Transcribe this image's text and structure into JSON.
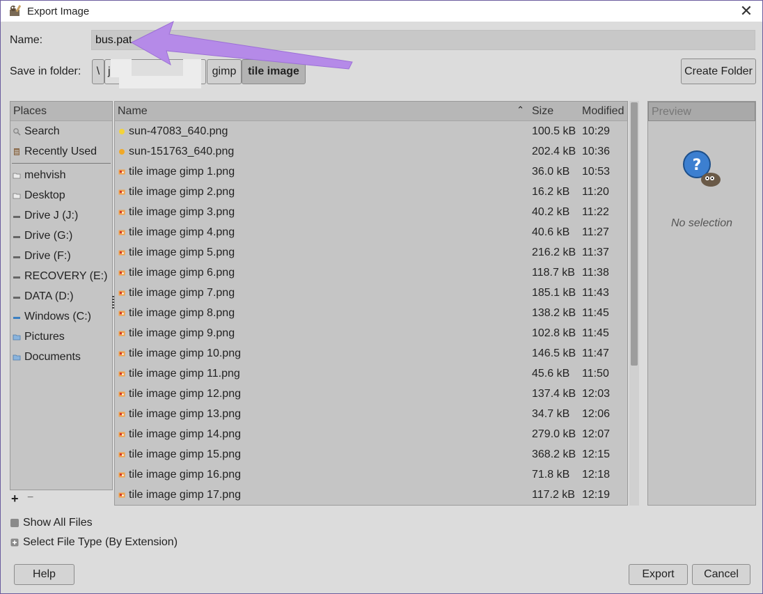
{
  "window": {
    "title": "Export Image",
    "close_icon": "close-icon"
  },
  "name_row": {
    "label": "Name:",
    "value": "bus.pat"
  },
  "folder_row": {
    "label": "Save in folder:",
    "crumbs": [
      "\\",
      "j",
      "gimp",
      "tile image"
    ],
    "create_folder": "Create Folder"
  },
  "places": {
    "header": "Places",
    "items": [
      {
        "label": "Search",
        "icon": "search-icon"
      },
      {
        "label": "Recently Used",
        "icon": "recent-icon"
      },
      {
        "label": "mehvish",
        "icon": "folder-icon"
      },
      {
        "label": "Desktop",
        "icon": "folder-icon"
      },
      {
        "label": "Drive J (J:)",
        "icon": "drive-icon"
      },
      {
        "label": "Drive (G:)",
        "icon": "drive-icon"
      },
      {
        "label": "Drive (F:)",
        "icon": "drive-icon"
      },
      {
        "label": "RECOVERY (E:)",
        "icon": "drive-icon"
      },
      {
        "label": "DATA (D:)",
        "icon": "drive-icon"
      },
      {
        "label": "Windows (C:)",
        "icon": "drive-icon"
      },
      {
        "label": "Pictures",
        "icon": "folder-icon"
      },
      {
        "label": "Documents",
        "icon": "folder-icon"
      }
    ],
    "add": "+",
    "remove": "−"
  },
  "files": {
    "headers": {
      "name": "Name",
      "size": "Size",
      "modified": "Modified"
    },
    "rows": [
      {
        "name": "sun-47083_640.png",
        "size": "100.5 kB",
        "modified": "10:29"
      },
      {
        "name": "sun-151763_640.png",
        "size": "202.4 kB",
        "modified": "10:36"
      },
      {
        "name": "tile image gimp 1.png",
        "size": "36.0 kB",
        "modified": "10:53"
      },
      {
        "name": "tile image gimp 2.png",
        "size": "16.2 kB",
        "modified": "11:20"
      },
      {
        "name": "tile image gimp 3.png",
        "size": "40.2 kB",
        "modified": "11:22"
      },
      {
        "name": "tile image gimp 4.png",
        "size": "40.6 kB",
        "modified": "11:27"
      },
      {
        "name": "tile image gimp 5.png",
        "size": "216.2 kB",
        "modified": "11:37"
      },
      {
        "name": "tile image gimp 6.png",
        "size": "118.7 kB",
        "modified": "11:38"
      },
      {
        "name": "tile image gimp 7.png",
        "size": "185.1 kB",
        "modified": "11:43"
      },
      {
        "name": "tile image gimp 8.png",
        "size": "138.2 kB",
        "modified": "11:45"
      },
      {
        "name": "tile image gimp 9.png",
        "size": "102.8 kB",
        "modified": "11:45"
      },
      {
        "name": "tile image gimp 10.png",
        "size": "146.5 kB",
        "modified": "11:47"
      },
      {
        "name": "tile image gimp 11.png",
        "size": "45.6 kB",
        "modified": "11:50"
      },
      {
        "name": "tile image gimp 12.png",
        "size": "137.4 kB",
        "modified": "12:03"
      },
      {
        "name": "tile image gimp 13.png",
        "size": "34.7 kB",
        "modified": "12:06"
      },
      {
        "name": "tile image gimp 14.png",
        "size": "279.0 kB",
        "modified": "12:07"
      },
      {
        "name": "tile image gimp 15.png",
        "size": "368.2 kB",
        "modified": "12:15"
      },
      {
        "name": "tile image gimp 16.png",
        "size": "71.8 kB",
        "modified": "12:18"
      },
      {
        "name": "tile image gimp 17.png",
        "size": "117.2 kB",
        "modified": "12:19"
      }
    ]
  },
  "preview": {
    "header": "Preview",
    "empty_text": "No selection"
  },
  "options": {
    "show_all": "Show All Files",
    "select_type": "Select File Type (By Extension)"
  },
  "buttons": {
    "help": "Help",
    "export": "Export",
    "cancel": "Cancel"
  },
  "colors": {
    "annotation_arrow": "#b58ae8",
    "window_border": "#6b5c9e"
  }
}
